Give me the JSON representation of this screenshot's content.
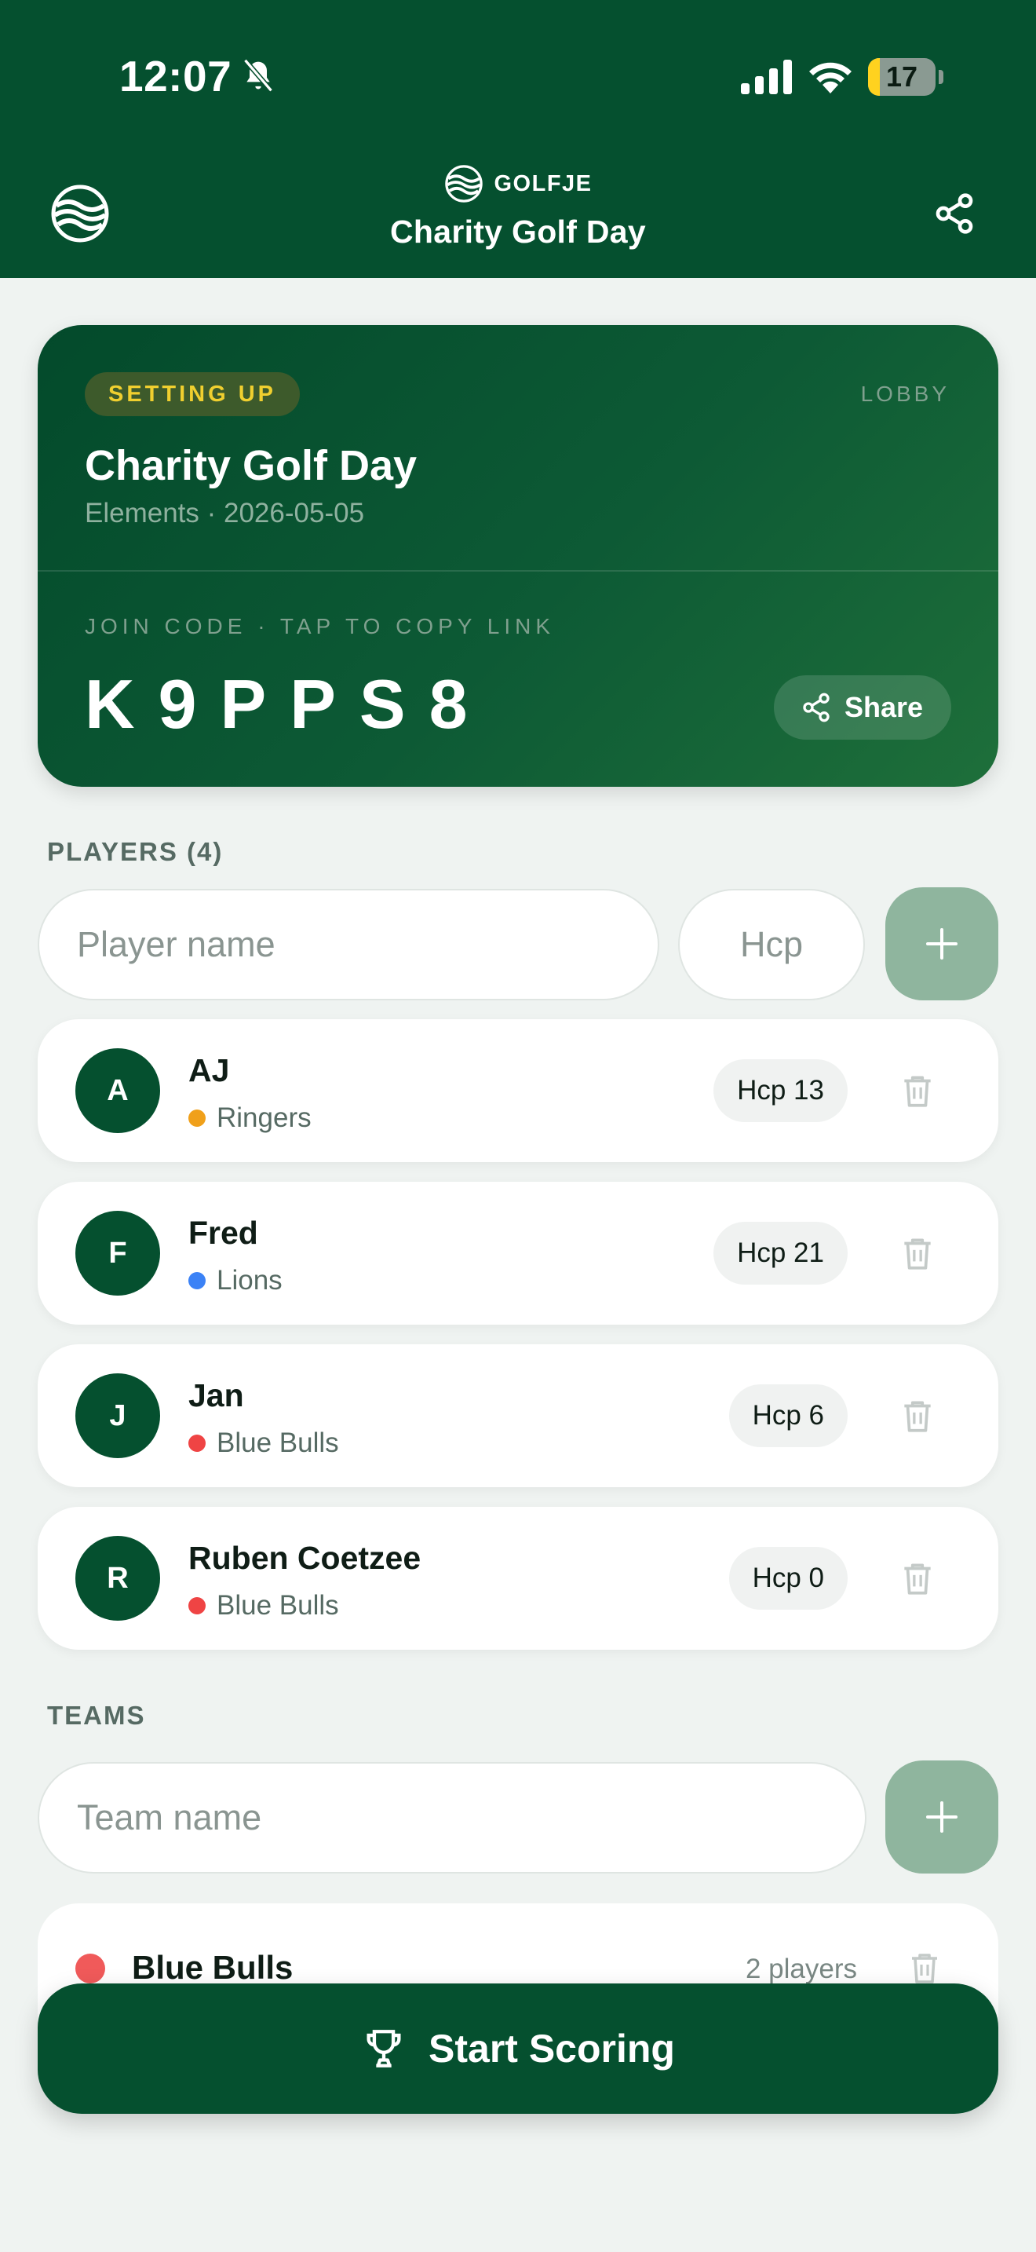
{
  "status_bar": {
    "time": "12:07",
    "battery": "17",
    "battery_level": 0.17
  },
  "header": {
    "brand": "GOLFJE",
    "title": "Charity Golf Day"
  },
  "hero": {
    "badge": "SETTING UP",
    "stage": "LOBBY",
    "title": "Charity Golf Day",
    "subtitle": "Elements · 2026-05-05",
    "join_label": "JOIN CODE · TAP TO COPY LINK",
    "join_code": "K9PPS8",
    "share_label": "Share"
  },
  "players": {
    "section_label": "PLAYERS (4)",
    "name_placeholder": "Player name",
    "hcp_placeholder": "Hcp",
    "items": [
      {
        "initial": "A",
        "name": "AJ",
        "team": "Ringers",
        "team_color": "#f0a01a",
        "hcp": "Hcp 13"
      },
      {
        "initial": "F",
        "name": "Fred",
        "team": "Lions",
        "team_color": "#3b82f6",
        "hcp": "Hcp 21"
      },
      {
        "initial": "J",
        "name": "Jan",
        "team": "Blue Bulls",
        "team_color": "#ef4444",
        "hcp": "Hcp 6"
      },
      {
        "initial": "R",
        "name": "Ruben Coetzee",
        "team": "Blue Bulls",
        "team_color": "#ef4444",
        "hcp": "Hcp 0"
      }
    ]
  },
  "teams": {
    "section_label": "TEAMS",
    "name_placeholder": "Team name",
    "items": [
      {
        "name": "Blue Bulls",
        "count": "2 players",
        "color": "#f05a5a"
      }
    ]
  },
  "actions": {
    "start_label": "Start Scoring"
  },
  "colors": {
    "primary": "#05502f",
    "badge_text": "#f0cf2f",
    "add_button": "#8fb59e"
  }
}
